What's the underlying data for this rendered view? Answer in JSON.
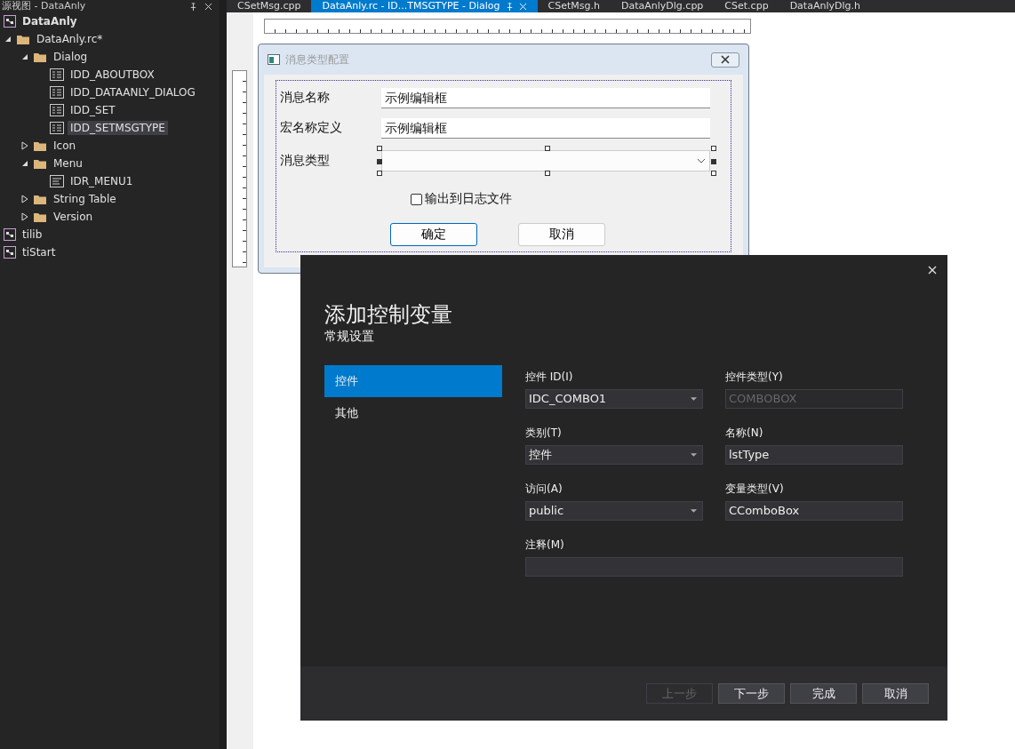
{
  "panel": {
    "title": "源视图 - DataAnly",
    "tree": [
      {
        "label": "DataAnly",
        "kind": "project",
        "selected": false
      },
      {
        "label": "DataAnly.rc*",
        "kind": "folder",
        "expanded": true,
        "selected": false,
        "children": [
          {
            "label": "Dialog",
            "kind": "folder",
            "expanded": true,
            "selected": false,
            "children": [
              {
                "label": "IDD_ABOUTBOX",
                "kind": "dialog",
                "selected": false
              },
              {
                "label": "IDD_DATAANLY_DIALOG",
                "kind": "dialog",
                "selected": false
              },
              {
                "label": "IDD_SET",
                "kind": "dialog",
                "selected": false
              },
              {
                "label": "IDD_SETMSGTYPE",
                "kind": "dialog",
                "selected": true
              }
            ]
          },
          {
            "label": "Icon",
            "kind": "folder",
            "expanded": false,
            "selected": false
          },
          {
            "label": "Menu",
            "kind": "folder",
            "expanded": true,
            "selected": false,
            "children": [
              {
                "label": "IDR_MENU1",
                "kind": "menu",
                "selected": false
              }
            ]
          },
          {
            "label": "String Table",
            "kind": "folder",
            "expanded": false,
            "selected": false
          },
          {
            "label": "Version",
            "kind": "folder",
            "expanded": false,
            "selected": false
          }
        ]
      },
      {
        "label": "tilib",
        "kind": "project",
        "selected": false
      },
      {
        "label": "tiStart",
        "kind": "project",
        "selected": false
      }
    ]
  },
  "editor_tabs": [
    {
      "label": "CSetMsg.cpp",
      "selected": false
    },
    {
      "label": "DataAnly.rc - ID...TMSGTYPE - Dialog",
      "selected": true
    },
    {
      "label": "CSetMsg.h",
      "selected": false
    },
    {
      "label": "DataAnlyDlg.cpp",
      "selected": false
    },
    {
      "label": "CSet.cpp",
      "selected": false
    },
    {
      "label": "DataAnlyDlg.h",
      "selected": false
    }
  ],
  "designer": {
    "title": "消息类型配置",
    "rows": [
      {
        "label": "消息名称",
        "kind": "edit",
        "value": "示例编辑框",
        "selected": false
      },
      {
        "label": "宏名称定义",
        "kind": "edit",
        "value": "示例编辑框",
        "selected": false
      },
      {
        "label": "消息类型",
        "kind": "combo",
        "selected": true
      }
    ],
    "checkbox": {
      "label": "输出到日志文件",
      "checked": false
    },
    "buttons": [
      {
        "label": "确定",
        "default": true
      },
      {
        "label": "取消",
        "default": false
      }
    ]
  },
  "wizard": {
    "title": "添加控制变量",
    "subtitle": "常规设置",
    "nav": [
      {
        "label": "控件",
        "selected": true
      },
      {
        "label": "其他",
        "selected": false
      }
    ],
    "fields": [
      {
        "label": "控件 ID(I)",
        "kind": "combo",
        "value": "IDC_COMBO1"
      },
      {
        "label": "控件类型(Y)",
        "kind": "disabled",
        "value": "COMBOBOX"
      },
      {
        "label": "类别(T)",
        "kind": "combo",
        "value": "控件"
      },
      {
        "label": "名称(N)",
        "kind": "text",
        "value": "lstType"
      },
      {
        "label": "访问(A)",
        "kind": "combo",
        "value": "public"
      },
      {
        "label": "变量类型(V)",
        "kind": "text",
        "value": "CComboBox"
      },
      {
        "label": "注释(M)",
        "kind": "wide"
      }
    ],
    "buttons": [
      {
        "label": "上一步",
        "disabled": true
      },
      {
        "label": "下一步",
        "disabled": false
      },
      {
        "label": "完成",
        "disabled": false
      },
      {
        "label": "取消",
        "disabled": false
      }
    ]
  }
}
